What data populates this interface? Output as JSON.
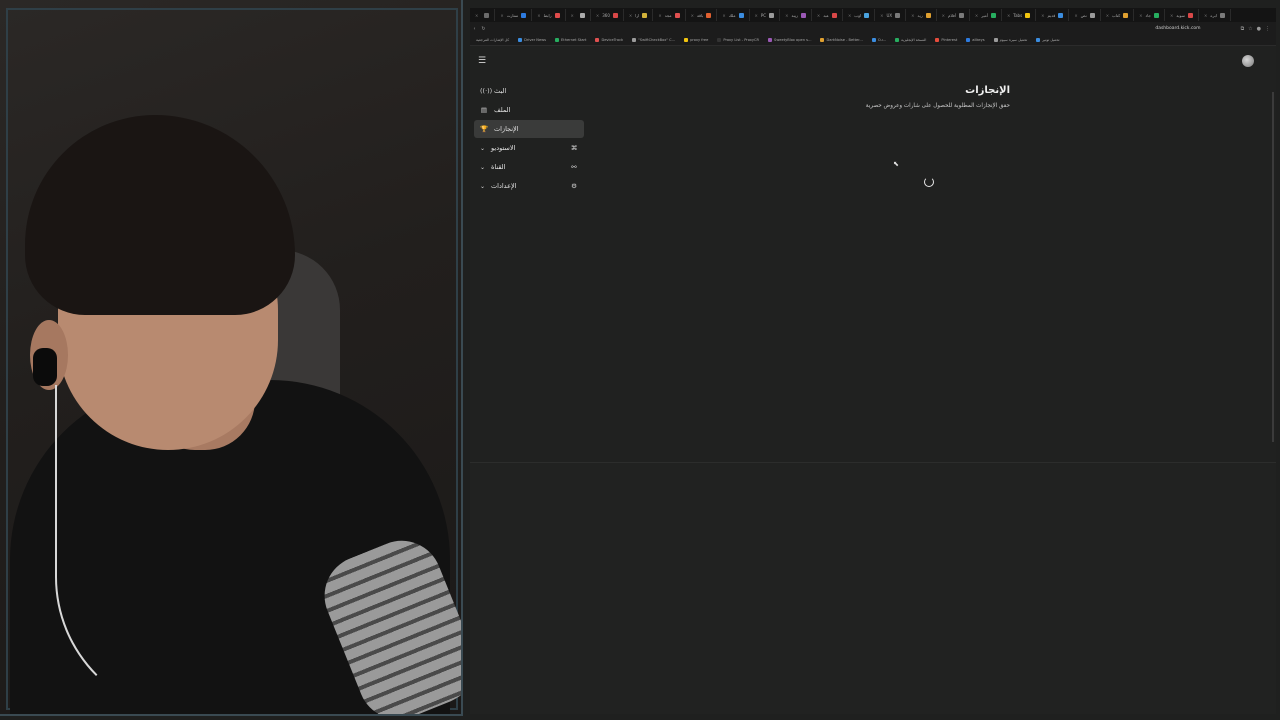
{
  "browser": {
    "tabs": [
      {
        "title": "",
        "color": "#6b6b6b"
      },
      {
        "title": "ستارت",
        "color": "#2d7be0"
      },
      {
        "title": "رابط",
        "color": "#e04b4b"
      },
      {
        "title": "",
        "color": "#aaaaaa"
      },
      {
        "title": "360",
        "color": "#d94848"
      },
      {
        "title": "ارا",
        "color": "#d2b23a"
      },
      {
        "title": "مجد",
        "color": "#e05050"
      },
      {
        "title": "باقة",
        "color": "#e06030"
      },
      {
        "title": "ملك",
        "color": "#3b8de0"
      },
      {
        "title": "PC",
        "color": "#9b9b9b"
      },
      {
        "title": "زيبة",
        "color": "#9b59b6"
      },
      {
        "title": "عبد",
        "color": "#d94848"
      },
      {
        "title": "اوب",
        "color": "#4aa3df"
      },
      {
        "title": "UX",
        "color": "#7a7a7a"
      },
      {
        "title": "ريد",
        "color": "#e0a030"
      },
      {
        "title": "أفلام",
        "color": "#7a7a7a"
      },
      {
        "title": "أمير",
        "color": "#27ae60"
      },
      {
        "title": "Tabs",
        "color": "#f1c40f"
      },
      {
        "title": "قديم",
        "color": "#3b8de0"
      },
      {
        "title": "نص",
        "color": "#9b9b9b"
      },
      {
        "title": "كتاب",
        "color": "#e0a030"
      },
      {
        "title": "جاد",
        "color": "#27ae60"
      },
      {
        "title": "سوية",
        "color": "#d94848"
      },
      {
        "title": "ابره",
        "color": "#7a7a7a"
      }
    ],
    "url": "dashboard.kick.com",
    "back_icon": "‹",
    "reload_icon": "↻",
    "bookmarks_left_label": "كل الإشارات المرجعية",
    "bookmarks": [
      {
        "label": "Driver News",
        "color": "#3b8de0"
      },
      {
        "label": "Ethernet Start",
        "color": "#27ae60"
      },
      {
        "label": "DeviceTrack",
        "color": "#e05050"
      },
      {
        "label": "\"SwiftCheckBox\" C...",
        "color": "#9b9b9b"
      },
      {
        "label": "proxy free",
        "color": "#f1c40f"
      },
      {
        "label": "Proxy List - ProxyCR",
        "color": "#333333"
      },
      {
        "label": "SweetyBlox open s...",
        "color": "#9b59b6"
      },
      {
        "label": "DarkNoise - Better...",
        "color": "#e0a030"
      },
      {
        "label": "Cu...",
        "color": "#3b8de0"
      },
      {
        "label": "النسخة الإنجليزية",
        "color": "#27ae60"
      },
      {
        "label": "Pinterest",
        "color": "#e74c3c"
      },
      {
        "label": "allkeys",
        "color": "#2d7be0"
      },
      {
        "label": "تحميل سيرة سيوم",
        "color": "#9b9b9b"
      },
      {
        "label": "تحميل توتير",
        "color": "#3b8de0"
      }
    ]
  },
  "sidebar": {
    "menu_icon": "☰",
    "items": [
      {
        "label": "البث",
        "icon": "((·))",
        "icon_name": "broadcast-icon",
        "chevron": "",
        "active": false
      },
      {
        "label": "الملف",
        "icon": "▤",
        "icon_name": "profile-card-icon",
        "chevron": "",
        "active": false
      },
      {
        "label": "الإنجازات",
        "icon": "🏆",
        "icon_name": "trophy-icon",
        "chevron": "",
        "active": true
      },
      {
        "label": "الاستوديو",
        "icon": "⌘",
        "icon_name": "studio-icon",
        "chevron": "⌄",
        "active": false
      },
      {
        "label": "القناة",
        "icon": "⚯",
        "icon_name": "channel-icon",
        "chevron": "⌄",
        "active": false
      },
      {
        "label": "الإعدادات",
        "icon": "⚙",
        "icon_name": "gear-icon",
        "chevron": "⌄",
        "active": false
      }
    ]
  },
  "main": {
    "title": "الإنجازات",
    "subtitle": "حقق الإنجازات المطلوبة للحصول على شارات وعروض حصرية"
  },
  "colors": {
    "page_bg": "#202120",
    "active_nav_bg": "#3a3b3a",
    "text": "#e4e4e4"
  }
}
